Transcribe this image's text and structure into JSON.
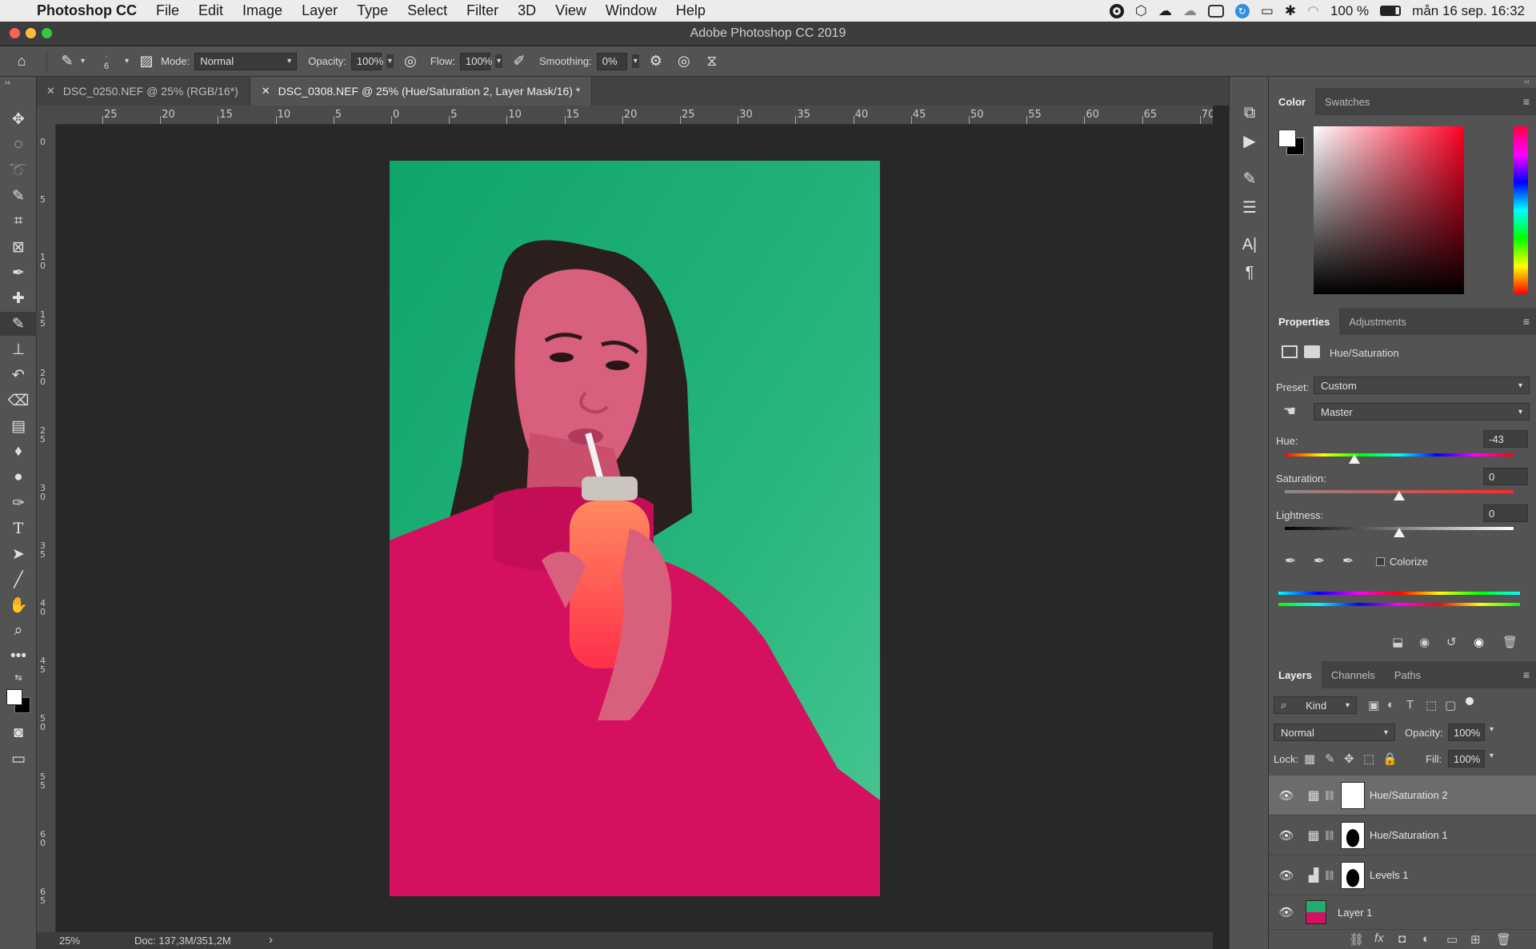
{
  "menubar": {
    "app_name": "Photoshop CC",
    "items": [
      "File",
      "Edit",
      "Image",
      "Layer",
      "Type",
      "Select",
      "Filter",
      "3D",
      "View",
      "Window",
      "Help"
    ],
    "battery": "100 %",
    "datetime": "mån 16 sep.  16:32"
  },
  "window": {
    "title": "Adobe Photoshop CC 2019"
  },
  "options": {
    "brush_size": "6",
    "mode_label": "Mode:",
    "mode_value": "Normal",
    "opacity_label": "Opacity:",
    "opacity_value": "100%",
    "flow_label": "Flow:",
    "flow_value": "100%",
    "smoothing_label": "Smoothing:",
    "smoothing_value": "0%"
  },
  "tabs": [
    {
      "label": "DSC_0250.NEF @ 25% (RGB/16*)",
      "active": false
    },
    {
      "label": "DSC_0308.NEF @ 25% (Hue/Saturation 2, Layer Mask/16) *",
      "active": true
    }
  ],
  "ruler": {
    "h_labels": [
      "25",
      "20",
      "15",
      "10",
      "5",
      "0",
      "5",
      "10",
      "15",
      "20",
      "25",
      "30",
      "35",
      "40",
      "45",
      "50",
      "55",
      "60",
      "65",
      "70"
    ],
    "v_labels": [
      "0",
      "5",
      "1\n0",
      "1\n5",
      "2\n0",
      "2\n5",
      "3\n0",
      "3\n5",
      "4\n0",
      "4\n5",
      "5\n0",
      "5\n5",
      "6\n0",
      "6\n5"
    ]
  },
  "status": {
    "zoom": "25%",
    "doc": "Doc: 137,3M/351,2M",
    "arrow": "›"
  },
  "color_panel": {
    "tabs": [
      "Color",
      "Swatches"
    ]
  },
  "properties_panel": {
    "tabs": [
      "Properties",
      "Adjustments"
    ],
    "title": "Hue/Saturation",
    "preset_label": "Preset:",
    "preset_value": "Custom",
    "channel_value": "Master",
    "hue_label": "Hue:",
    "hue_value": "-43",
    "saturation_label": "Saturation:",
    "saturation_value": "0",
    "lightness_label": "Lightness:",
    "lightness_value": "0",
    "colorize_label": "Colorize"
  },
  "layers_panel": {
    "tabs": [
      "Layers",
      "Channels",
      "Paths"
    ],
    "kind_label": "Kind",
    "blend_value": "Normal",
    "opacity_label": "Opacity:",
    "opacity_value": "100%",
    "lock_label": "Lock:",
    "fill_label": "Fill:",
    "fill_value": "100%",
    "layers": [
      {
        "name": "Hue/Saturation 2",
        "selected": true
      },
      {
        "name": "Hue/Saturation 1",
        "selected": false
      },
      {
        "name": "Levels 1",
        "selected": false
      },
      {
        "name": "Layer 1",
        "selected": false
      }
    ]
  },
  "colors": {
    "photo_bg": "#1fae72",
    "sweater": "#d5105f",
    "ui_panel": "#535353"
  }
}
